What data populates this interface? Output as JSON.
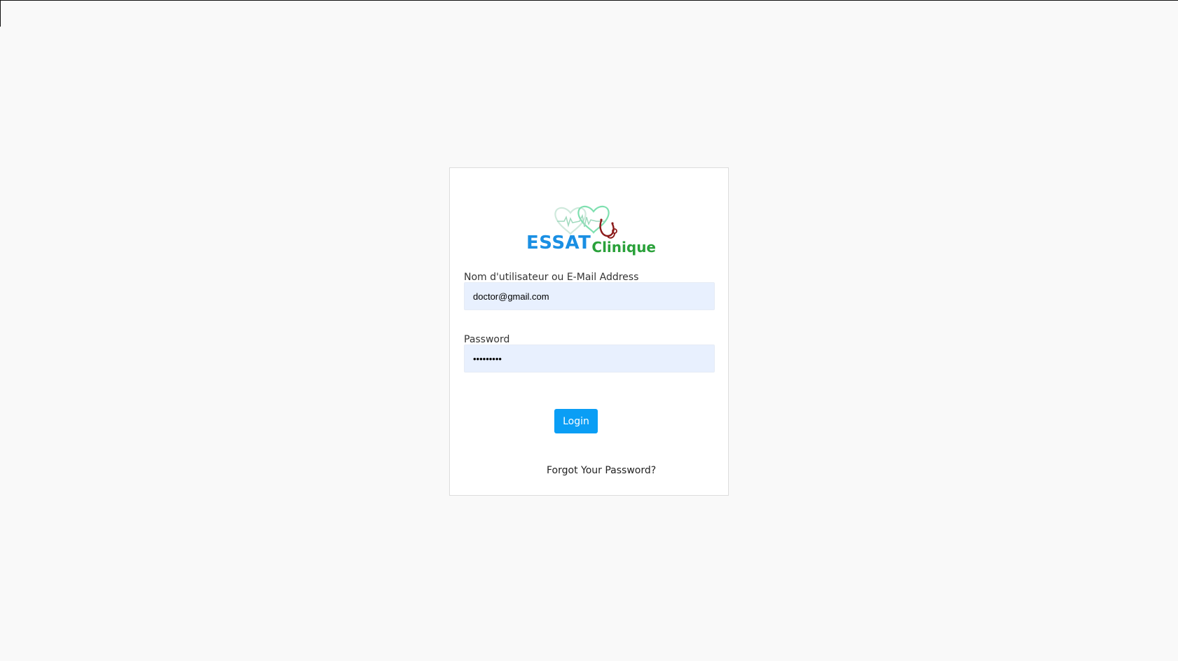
{
  "brand": {
    "name_part1": "ESSAT",
    "name_part2": "Clinique",
    "color_part1": "#1a8fe3",
    "color_part2": "#2aa13a",
    "logo_icon": "heartbeat-stethoscope-icon"
  },
  "login_form": {
    "username_label": "Nom d'utilisateur ou E-Mail Address",
    "username_value": "doctor@gmail.com",
    "password_label": "Password",
    "password_value": "123456789",
    "login_button_label": "Login",
    "forgot_password_label": "Forgot Your Password?"
  },
  "colors": {
    "page_background": "#f9f9f9",
    "input_background": "#e8f0fe",
    "button_accent": "#0a9ef5"
  }
}
